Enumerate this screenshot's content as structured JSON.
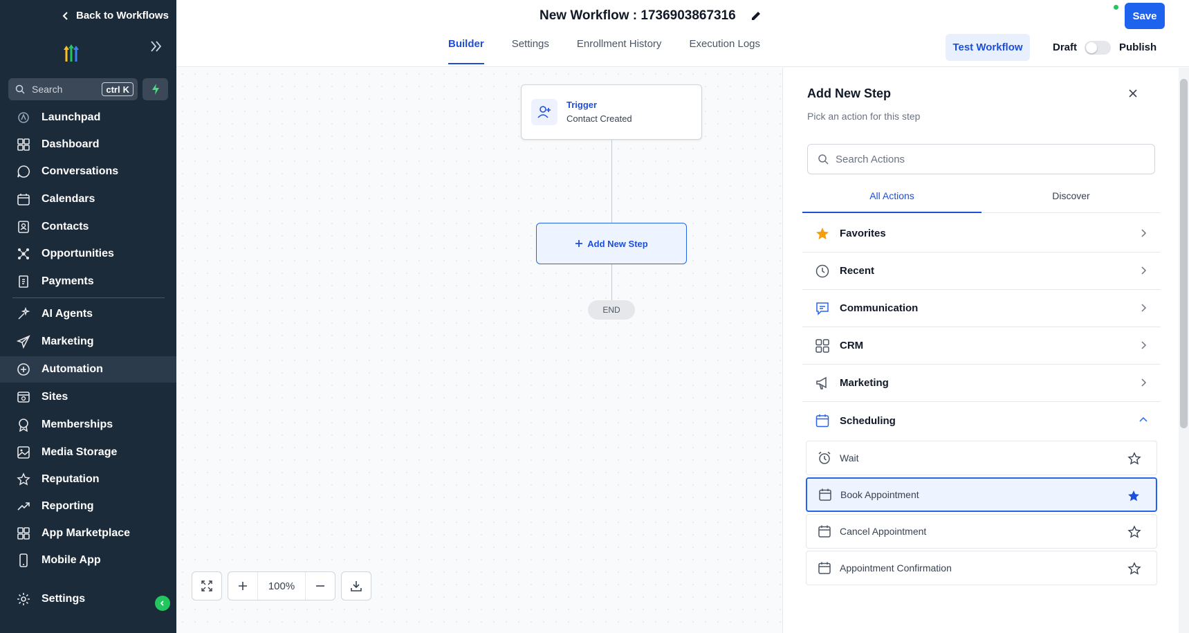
{
  "sidebar": {
    "back_label": "Back to Workflows",
    "search_placeholder": "Search",
    "search_kbd_ctrl": "ctrl",
    "search_kbd_key": "K",
    "items": [
      {
        "label": "Launchpad",
        "icon": "launchpad-icon"
      },
      {
        "label": "Dashboard",
        "icon": "dashboard-icon"
      },
      {
        "label": "Conversations",
        "icon": "chat-icon"
      },
      {
        "label": "Calendars",
        "icon": "calendar-icon"
      },
      {
        "label": "Contacts",
        "icon": "contacts-icon"
      },
      {
        "label": "Opportunities",
        "icon": "opportunities-icon"
      },
      {
        "label": "Payments",
        "icon": "payments-icon"
      },
      {
        "label": "AI Agents",
        "icon": "ai-agents-icon"
      },
      {
        "label": "Marketing",
        "icon": "send-icon"
      },
      {
        "label": "Automation",
        "icon": "automation-icon"
      },
      {
        "label": "Sites",
        "icon": "sites-icon"
      },
      {
        "label": "Memberships",
        "icon": "memberships-icon"
      },
      {
        "label": "Media Storage",
        "icon": "image-icon"
      },
      {
        "label": "Reputation",
        "icon": "star-icon"
      },
      {
        "label": "Reporting",
        "icon": "reporting-icon"
      },
      {
        "label": "App Marketplace",
        "icon": "apps-icon"
      },
      {
        "label": "Mobile App",
        "icon": "mobile-icon"
      },
      {
        "label": "Settings",
        "icon": "gear-icon"
      }
    ],
    "active_item": "Automation"
  },
  "header": {
    "title": "New Workflow : 1736903867316",
    "tabs": [
      "Builder",
      "Settings",
      "Enrollment History",
      "Execution Logs"
    ],
    "active_tab": "Builder",
    "test_label": "Test Workflow",
    "draft_label": "Draft",
    "publish_label": "Publish",
    "save_label": "Save"
  },
  "canvas": {
    "trigger_title": "Trigger",
    "trigger_subtitle": "Contact Created",
    "add_step_label": "Add New Step",
    "end_label": "END",
    "zoom": "100%"
  },
  "panel": {
    "title": "Add New Step",
    "subtitle": "Pick an action for this step",
    "search_placeholder": "Search Actions",
    "tabs": [
      "All Actions",
      "Discover"
    ],
    "categories": [
      {
        "label": "Favorites",
        "icon": "star-filled-icon"
      },
      {
        "label": "Recent",
        "icon": "clock-icon"
      },
      {
        "label": "Communication",
        "icon": "message-icon"
      },
      {
        "label": "CRM",
        "icon": "grid-icon"
      },
      {
        "label": "Marketing",
        "icon": "megaphone-icon"
      },
      {
        "label": "Scheduling",
        "icon": "calendar-icon"
      }
    ],
    "scheduling_items": [
      {
        "label": "Wait",
        "icon": "alarm-icon",
        "favorite": false
      },
      {
        "label": "Book Appointment",
        "icon": "calendar-icon",
        "favorite": true
      },
      {
        "label": "Cancel Appointment",
        "icon": "calendar-icon",
        "favorite": false
      },
      {
        "label": "Appointment Confirmation",
        "icon": "calendar-icon",
        "favorite": false
      }
    ]
  },
  "colors": {
    "sidebar_bg": "#1c2b3a",
    "accent": "#1d63ed",
    "favorite_star": "#f59e0b"
  }
}
